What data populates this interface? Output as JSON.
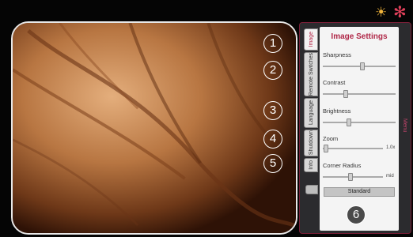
{
  "callouts": [
    "1",
    "2",
    "3",
    "4",
    "5",
    "6"
  ],
  "icons": {
    "brightness": "sun-icon",
    "fan": "fan-icon"
  },
  "drawer": {
    "edge_label": "Menu",
    "tabs": [
      "Image",
      "Remote Switches",
      "Language",
      "Shutdown",
      "Info"
    ],
    "active_tab": "Image"
  },
  "settings": {
    "title": "Image Settings",
    "sharpness": {
      "label": "Sharpness",
      "level": 0.55
    },
    "contrast": {
      "label": "Contrast",
      "level": 0.3
    },
    "brightness": {
      "label": "Brightness",
      "level": 0.35
    },
    "zoom": {
      "label": "Zoom",
      "level": 0.02,
      "value": "1.0x"
    },
    "corner_radius": {
      "label": "Corner Radius",
      "level": 0.45,
      "value": "mid"
    },
    "standard_button": "Standard"
  },
  "colors": {
    "accent": "#b02848",
    "sun": "#f0b43c",
    "fan": "#e0405a",
    "drawer_border": "#7a1f38"
  }
}
